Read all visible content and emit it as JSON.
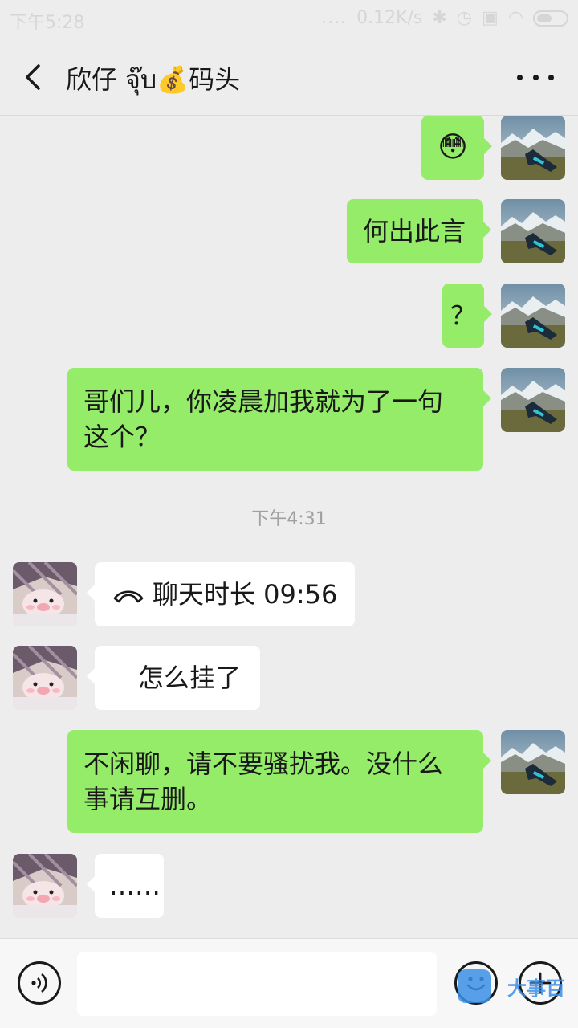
{
  "status_bar": {
    "time": "下午5:28",
    "signal_dots": "....",
    "net_speed": "0.12K/s"
  },
  "header": {
    "title": "欣仔 จุ๊บ💰码头"
  },
  "messages": [
    {
      "from": "me",
      "text": "😳"
    },
    {
      "from": "me",
      "text": "何出此言"
    },
    {
      "from": "me",
      "text": "？"
    },
    {
      "from": "me",
      "text": "哥们儿，你凌晨加我就为了一句这个？"
    },
    {
      "from": "system",
      "text": "下午4:31"
    },
    {
      "from": "other",
      "call_label": "聊天时长 09:56"
    },
    {
      "from": "other",
      "text": "怎么挂了"
    },
    {
      "from": "me",
      "text": "不闲聊，请不要骚扰我。没什么事请互删。"
    },
    {
      "from": "other",
      "text": "……"
    }
  ],
  "bottom_bar": {
    "input_value": "",
    "watermark": "大事百"
  },
  "colors": {
    "my_bubble": "#95ec69",
    "their_bubble": "#ffffff",
    "background": "#ededed"
  }
}
